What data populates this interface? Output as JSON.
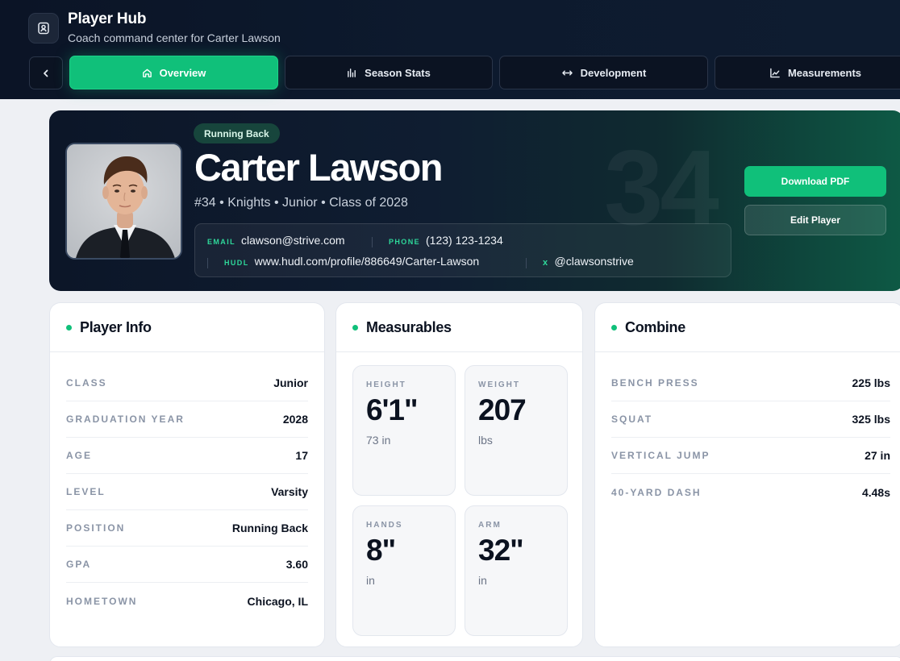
{
  "header": {
    "title": "Player Hub",
    "subtitle": "Coach command center for Carter Lawson"
  },
  "tabs": [
    {
      "label": "Overview",
      "icon": "home-icon",
      "active": true
    },
    {
      "label": "Season Stats",
      "icon": "bar-chart-icon",
      "active": false
    },
    {
      "label": "Development",
      "icon": "arrows-horizontal-icon",
      "active": false
    },
    {
      "label": "Measurements",
      "icon": "line-chart-icon",
      "active": false
    }
  ],
  "hero": {
    "position_badge": "Running Back",
    "name": "Carter Lawson",
    "meta": "#34 • Knights • Junior • Class of 2028",
    "jersey_number": "34",
    "contact": {
      "email_label": "EMAIL",
      "email": "clawson@strive.com",
      "phone_label": "PHONE",
      "phone": "(123) 123-1234",
      "hudl_label": "HUDL",
      "hudl": "www.hudl.com/profile/886649/Carter-Lawson",
      "x_label": "X",
      "x": "@clawsonstrive"
    },
    "download_label": "Download PDF",
    "edit_label": "Edit Player"
  },
  "player_info": {
    "title": "Player Info",
    "rows": [
      {
        "k": "CLASS",
        "v": "Junior"
      },
      {
        "k": "GRADUATION YEAR",
        "v": "2028"
      },
      {
        "k": "AGE",
        "v": "17"
      },
      {
        "k": "LEVEL",
        "v": "Varsity"
      },
      {
        "k": "POSITION",
        "v": "Running Back"
      },
      {
        "k": "GPA",
        "v": "3.60"
      },
      {
        "k": "HOMETOWN",
        "v": "Chicago, IL"
      }
    ]
  },
  "measurables": {
    "title": "Measurables",
    "tiles": [
      {
        "label": "HEIGHT",
        "value": "6'1\"",
        "unit": "73 in"
      },
      {
        "label": "WEIGHT",
        "value": "207",
        "unit": "lbs"
      },
      {
        "label": "HANDS",
        "value": "8\"",
        "unit": "in"
      },
      {
        "label": "ARM",
        "value": "32\"",
        "unit": "in"
      }
    ]
  },
  "combine": {
    "title": "Combine",
    "rows": [
      {
        "k": "BENCH PRESS",
        "v": "225 lbs"
      },
      {
        "k": "SQUAT",
        "v": "325 lbs"
      },
      {
        "k": "VERTICAL JUMP",
        "v": "27 in"
      },
      {
        "k": "40-YARD DASH",
        "v": "4.48s"
      }
    ]
  },
  "colors": {
    "accent": "#10c07a",
    "header_bg": "#0b1426"
  }
}
